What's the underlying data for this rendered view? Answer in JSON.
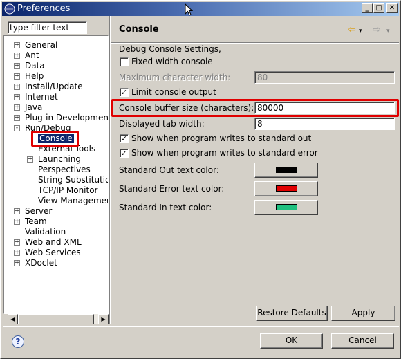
{
  "window": {
    "title": "Preferences"
  },
  "filter": {
    "placeholder": "type filter text"
  },
  "tree": {
    "items": [
      {
        "label": "General",
        "expander": "+"
      },
      {
        "label": "Ant",
        "expander": "+"
      },
      {
        "label": "Data",
        "expander": "+"
      },
      {
        "label": "Help",
        "expander": "+"
      },
      {
        "label": "Install/Update",
        "expander": "+"
      },
      {
        "label": "Internet",
        "expander": "+"
      },
      {
        "label": "Java",
        "expander": "+"
      },
      {
        "label": "Plug-in Development",
        "expander": "+"
      },
      {
        "label": "Run/Debug",
        "expander": "-"
      },
      {
        "label": "Console",
        "expander": ""
      },
      {
        "label": "External Tools",
        "expander": ""
      },
      {
        "label": "Launching",
        "expander": "+"
      },
      {
        "label": "Perspectives",
        "expander": ""
      },
      {
        "label": "String Substitution",
        "expander": ""
      },
      {
        "label": "TCP/IP Monitor",
        "expander": ""
      },
      {
        "label": "View Managemen",
        "expander": ""
      },
      {
        "label": "Server",
        "expander": "+"
      },
      {
        "label": "Team",
        "expander": "+"
      },
      {
        "label": "Validation",
        "expander": ""
      },
      {
        "label": "Web and XML",
        "expander": "+"
      },
      {
        "label": "Web Services",
        "expander": "+"
      },
      {
        "label": "XDoclet",
        "expander": "+"
      }
    ]
  },
  "page": {
    "title": "Console",
    "section_label": "Debug Console Settings,",
    "fixed_width_label": "Fixed width console",
    "fixed_width_checked": false,
    "max_char_width_label": "Maximum character width:",
    "max_char_width_value": "80",
    "limit_output_label": "Limit console output",
    "limit_output_checked": true,
    "buffer_size_label": "Console buffer size (characters):",
    "buffer_size_value": "80000",
    "tab_width_label": "Displayed tab width:",
    "tab_width_value": "8",
    "show_out_label": "Show when program writes to standard out",
    "show_out_checked": true,
    "show_err_label": "Show when program writes to standard error",
    "show_err_checked": true,
    "out_color_label": "Standard Out text color:",
    "err_color_label": "Standard Error text color:",
    "in_color_label": "Standard In text color:",
    "restore_defaults": "Restore Defaults",
    "apply": "Apply"
  },
  "colors": {
    "std_out": "#000000",
    "std_err": "#e00000",
    "std_in": "#20c080",
    "highlight": "#e00000"
  },
  "footer": {
    "ok": "OK",
    "cancel": "Cancel"
  },
  "icons": [
    "eclipse-icon",
    "back-arrow-icon",
    "forward-arrow-icon",
    "help-icon"
  ]
}
